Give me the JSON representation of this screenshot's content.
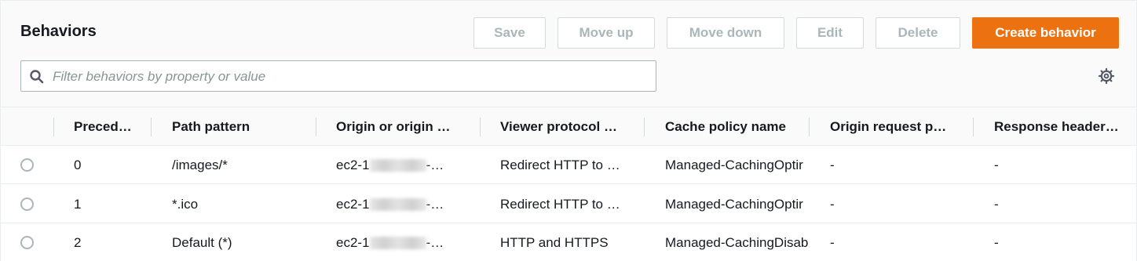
{
  "title": "Behaviors",
  "buttons": {
    "save": "Save",
    "move_up": "Move up",
    "move_down": "Move down",
    "edit": "Edit",
    "delete": "Delete",
    "create": "Create behavior"
  },
  "search": {
    "placeholder": "Filter behaviors by property or value"
  },
  "columns": [
    "Preced…",
    "Path pattern",
    "Origin or origin …",
    "Viewer protocol …",
    "Cache policy name",
    "Origin request p…",
    "Response header…"
  ],
  "rows": [
    {
      "precedence": "0",
      "path": "/images/*",
      "origin_prefix": "ec2-1",
      "origin_suffix": "-…",
      "viewer": "Redirect HTTP to …",
      "cache": "Managed-CachingOptir",
      "origin_req": "-",
      "response": "-"
    },
    {
      "precedence": "1",
      "path": "*.ico",
      "origin_prefix": "ec2-1",
      "origin_suffix": "-…",
      "viewer": "Redirect HTTP to …",
      "cache": "Managed-CachingOptir",
      "origin_req": "-",
      "response": "-"
    },
    {
      "precedence": "2",
      "path": "Default (*)",
      "origin_prefix": "ec2-1",
      "origin_suffix": "-…",
      "viewer": "HTTP and HTTPS",
      "cache": "Managed-CachingDisab",
      "origin_req": "-",
      "response": "-"
    }
  ],
  "colors": {
    "accent": "#ec7211",
    "disabled_text": "#aab7b8",
    "border": "#eaeded"
  },
  "icons": {
    "search": "search-icon",
    "settings": "gear-icon"
  }
}
